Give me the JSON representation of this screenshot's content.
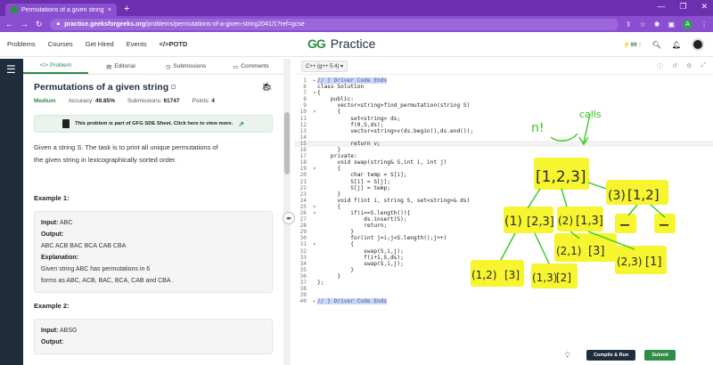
{
  "browser": {
    "tab_title": "Permutations of a given string | P",
    "new_tab": "+",
    "window_controls": [
      "—",
      "❐",
      "✕"
    ],
    "url_domain": "practice.geeksforgeeks.org",
    "url_path": "/problems/permutations-of-a-given-string2041/1?ref=gcse",
    "profile_initial": "A"
  },
  "header": {
    "nav": [
      "Problems",
      "Courses",
      "Get Hired",
      "Events",
      "</>POTD"
    ],
    "logo_mark": "GG",
    "logo_word": "Practice",
    "streak": "99"
  },
  "tabs": [
    "</> Problem",
    "Editorial",
    "Submissions",
    "Comments"
  ],
  "problem": {
    "title": "Permutations of a given string",
    "difficulty": "Medium",
    "accuracy_label": "Accuracy:",
    "accuracy": "49.85%",
    "submissions_label": "Submissions:",
    "submissions": "61747",
    "points_label": "Points:",
    "points": "4",
    "sde_banner": "This problem is part of GFG SDE Sheet. Click here to view more.",
    "description_1": "Given a string S. The task is to print all unique permutations of",
    "description_2": "the given string in lexicographically sorted order.",
    "example1_title": "Example 1:",
    "ex1_input_label": "Input:",
    "ex1_input": "ABC",
    "ex1_output_label": "Output:",
    "ex1_output": "ABC ACB BAC BCA CAB CBA",
    "ex1_expl_label": "Explanation:",
    "ex1_expl_1": "Given string ABC has permutations in 6",
    "ex1_expl_2": "forms as ABC, ACB, BAC, BCA, CAB and CBA .",
    "example2_title": "Example 2:",
    "ex2_input_label": "Input:",
    "ex2_input": "ABSG",
    "ex2_output_label": "Output:"
  },
  "editor": {
    "language": "C++ (g++ 5.4)",
    "lines": [
      {
        "n": "1",
        "fold": "▸",
        "text": "// } Driver Code Ends",
        "hl": true
      },
      {
        "n": "6",
        "fold": "",
        "text": "class Solution"
      },
      {
        "n": "7",
        "fold": "▾",
        "text": "{"
      },
      {
        "n": "8",
        "fold": "",
        "text": "    public:"
      },
      {
        "n": "9",
        "fold": "",
        "text": "      vector<string>find_permutation(string S)"
      },
      {
        "n": "10",
        "fold": "▾",
        "text": "      {"
      },
      {
        "n": "11",
        "fold": "",
        "text": "          set<string> ds;"
      },
      {
        "n": "12",
        "fold": "",
        "text": "          f(0,S,ds);"
      },
      {
        "n": "13",
        "fold": "",
        "text": "          vector<string>v(ds.begin(),ds.end());"
      },
      {
        "n": "14",
        "fold": "",
        "text": ""
      },
      {
        "n": "15",
        "fold": "",
        "text": "          return v;",
        "cur": true
      },
      {
        "n": "16",
        "fold": "",
        "text": "      }"
      },
      {
        "n": "17",
        "fold": "",
        "text": "    private:"
      },
      {
        "n": "18",
        "fold": "",
        "text": "      void swap(string& S,int i, int j)"
      },
      {
        "n": "19",
        "fold": "▾",
        "text": "      {"
      },
      {
        "n": "20",
        "fold": "",
        "text": "          char temp = S[i];"
      },
      {
        "n": "21",
        "fold": "",
        "text": "          S[i] = S[j];"
      },
      {
        "n": "22",
        "fold": "",
        "text": "          S[j] = temp;"
      },
      {
        "n": "23",
        "fold": "",
        "text": "      }"
      },
      {
        "n": "24",
        "fold": "",
        "text": "      void f(int i, string S, set<string>& ds)"
      },
      {
        "n": "25",
        "fold": "▾",
        "text": "      {"
      },
      {
        "n": "26",
        "fold": "▾",
        "text": "          if(i==S.length()){"
      },
      {
        "n": "27",
        "fold": "",
        "text": "              ds.insert(S);"
      },
      {
        "n": "28",
        "fold": "",
        "text": "              return;"
      },
      {
        "n": "29",
        "fold": "",
        "text": "          }"
      },
      {
        "n": "30",
        "fold": "",
        "text": "          for(int j=i;j<S.length();j++)"
      },
      {
        "n": "31",
        "fold": "▾",
        "text": "          {"
      },
      {
        "n": "32",
        "fold": "",
        "text": "              swap(S,i,j);"
      },
      {
        "n": "33",
        "fold": "",
        "text": "              f(i+1,S,ds);"
      },
      {
        "n": "34",
        "fold": "",
        "text": "              swap(S,i,j);"
      },
      {
        "n": "35",
        "fold": "",
        "text": "          }"
      },
      {
        "n": "36",
        "fold": "",
        "text": "      }"
      },
      {
        "n": "37",
        "fold": "",
        "text": "};"
      },
      {
        "n": "38",
        "fold": "",
        "text": ""
      },
      {
        "n": "39",
        "fold": "",
        "text": ""
      },
      {
        "n": "40",
        "fold": "▸",
        "text": "// } Driver Code Ends",
        "hl": true
      }
    ],
    "compile_label": "Compile & Run",
    "submit_label": "Submit"
  },
  "annotations": {
    "color_highlight": "#f7f31a",
    "color_ink": "#36c81c",
    "top_left": "n!",
    "top_right": "calls",
    "root": "[1,2,3]",
    "l1_left": "(1)",
    "l1_left_b": "[2,3]",
    "l1_mid": "(2)",
    "l1_mid_b": "[1,3]",
    "l1_right": "(3)",
    "l1_right_b": "[1,2]",
    "l2_a": "(1,2)",
    "l2_a_b": "[3]",
    "l2_b": "(1,3)",
    "l2_b_b": "[2]",
    "l2_c": "(2,1)",
    "l2_c_b": "[3]",
    "l2_d": "(2,3)",
    "l2_d_b": "[1]"
  }
}
